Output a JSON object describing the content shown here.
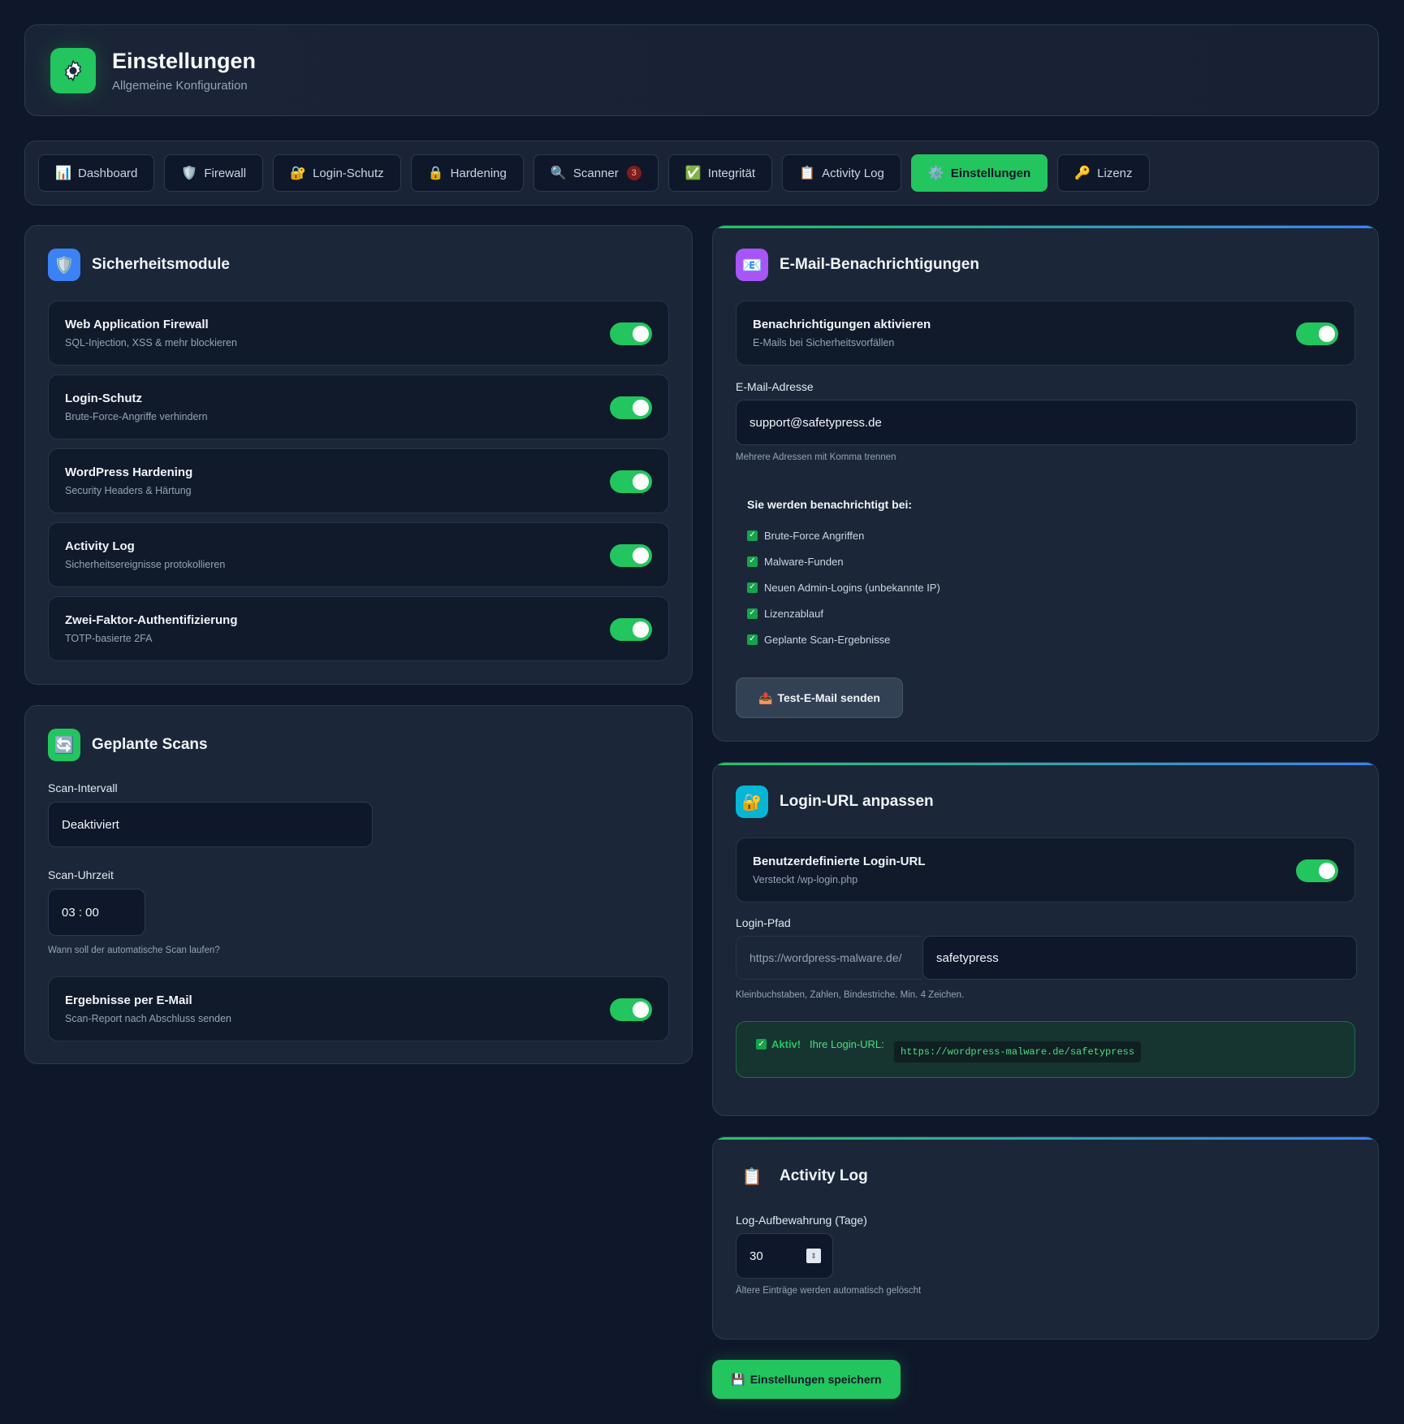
{
  "header": {
    "title": "Einstellungen",
    "subtitle": "Allgemeine Konfiguration"
  },
  "nav": {
    "tabs": [
      {
        "label": "Dashboard",
        "icon": "📊"
      },
      {
        "label": "Firewall",
        "icon": "🛡️"
      },
      {
        "label": "Login-Schutz",
        "icon": "🔐"
      },
      {
        "label": "Hardening",
        "icon": "🔒"
      },
      {
        "label": "Scanner",
        "icon": "🔍",
        "badge": "3"
      },
      {
        "label": "Integrität",
        "icon": "✅"
      },
      {
        "label": "Activity Log",
        "icon": "📋"
      },
      {
        "label": "Einstellungen",
        "icon": "⚙️"
      },
      {
        "label": "Lizenz",
        "icon": "🔑"
      }
    ],
    "active": "Einstellungen"
  },
  "security_modules": {
    "title": "Sicherheitsmodule",
    "items": [
      {
        "title": "Web Application Firewall",
        "sub": "SQL-Injection, XSS & mehr blockieren",
        "enabled": true
      },
      {
        "title": "Login-Schutz",
        "sub": "Brute-Force-Angriffe verhindern",
        "enabled": true
      },
      {
        "title": "WordPress Hardening",
        "sub": "Security Headers & Härtung",
        "enabled": true
      },
      {
        "title": "Activity Log",
        "sub": "Sicherheitsereignisse protokollieren",
        "enabled": true
      },
      {
        "title": "Zwei-Faktor-Authentifizierung",
        "sub": "TOTP-basierte 2FA",
        "enabled": true
      }
    ]
  },
  "scheduled_scans": {
    "title": "Geplante Scans",
    "interval_label": "Scan-Intervall",
    "interval_value": "Deaktiviert",
    "time_label": "Scan-Uhrzeit",
    "time_value": "03 : 00",
    "time_hint": "Wann soll der automatische Scan laufen?",
    "email_row": {
      "title": "Ergebnisse per E-Mail",
      "sub": "Scan-Report nach Abschluss senden",
      "enabled": true
    }
  },
  "email": {
    "title": "E-Mail-Benachrichtigungen",
    "enable_row": {
      "title": "Benachrichtigungen aktivieren",
      "sub": "E-Mails bei Sicherheitsvorfällen",
      "enabled": true
    },
    "address_label": "E-Mail-Adresse",
    "address_value": "support@safetypress.de",
    "address_hint": "Mehrere Adressen mit Komma trennen",
    "notify_head": "Sie werden benachrichtigt bei:",
    "notify_items": [
      "Brute-Force Angriffen",
      "Malware-Funden",
      "Neuen Admin-Logins (unbekannte IP)",
      "Lizenzablauf",
      "Geplante Scan-Ergebnisse"
    ],
    "test_button": "Test-E-Mail senden"
  },
  "login_url": {
    "title": "Login-URL anpassen",
    "custom_row": {
      "title": "Benutzerdefinierte Login-URL",
      "sub": "Versteckt /wp-login.php",
      "enabled": true
    },
    "path_label": "Login-Pfad",
    "prefix": "https://wordpress-malware.de/",
    "path_value": "safetypress",
    "path_hint": "Kleinbuchstaben, Zahlen, Bindestriche. Min. 4 Zeichen.",
    "status_ok": "Aktiv!",
    "status_label": "Ihre Login-URL:",
    "status_url": "https://wordpress-malware.de/safetypress"
  },
  "activity_log": {
    "title": "Activity Log",
    "retention_label": "Log-Aufbewahrung (Tage)",
    "retention_value": "30",
    "retention_hint": "Ältere Einträge werden automatisch gelöscht"
  },
  "save_button": "Einstellungen speichern",
  "colors": {
    "background": "#0f172a",
    "card": "#1b2639",
    "accent": "#22c55e",
    "accent_blue": "#3b82f6"
  }
}
